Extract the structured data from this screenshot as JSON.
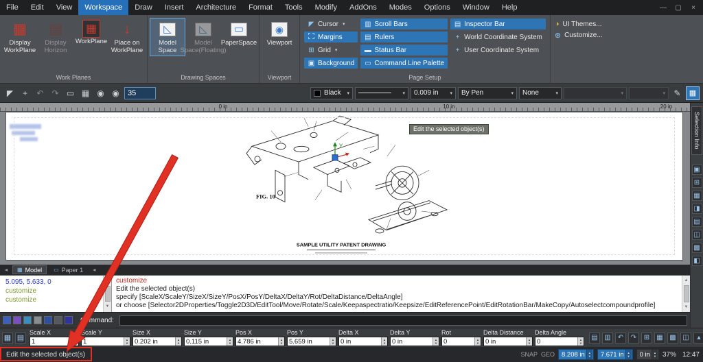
{
  "colors": {
    "accent_blue": "#2e75b6",
    "annotation_red": "#e13024",
    "history_red": "#c3231a",
    "history_green": "#7f9a33",
    "history_blue": "#2b3fd0",
    "ribbon_gray": "#4d5054"
  },
  "icons": {
    "caret": "▾",
    "spin_up": "▲",
    "spin_down": "▼",
    "nav_left": "◂",
    "scroll_up": "▲",
    "scroll_down": "▼"
  },
  "window_controls": {
    "minimize": "—",
    "maximize": "▢",
    "close": "×"
  },
  "menubar": {
    "items": [
      "File",
      "Edit",
      "View",
      "Workspace",
      "Draw",
      "Insert",
      "Architecture",
      "Format",
      "Tools",
      "Modify",
      "AddOns",
      "Modes",
      "Options",
      "Window",
      "Help"
    ]
  },
  "ribbon": {
    "work_planes": {
      "label": "Work Planes",
      "buttons": [
        {
          "label": "Display WorkPlane",
          "icon": "▦"
        },
        {
          "label": "Display Horizon",
          "icon": "▤"
        },
        {
          "label": "WorkPlane",
          "icon": "▦"
        },
        {
          "label": "Place on WorkPlane",
          "icon": "↓"
        }
      ]
    },
    "drawing_spaces": {
      "label": "Drawing Spaces",
      "buttons": [
        {
          "label": "Model Space",
          "icon": "◺"
        },
        {
          "label": "Model Space(Floating)",
          "icon": "◺"
        },
        {
          "label": "PaperSpace",
          "icon": "▭"
        }
      ]
    },
    "viewport_group": {
      "label": "Viewport",
      "buttons": [
        {
          "label": "Viewport",
          "icon": "◉"
        }
      ]
    },
    "page_setup": {
      "label": "Page Setup",
      "toggles": [
        {
          "label": "Cursor",
          "icon": "◤"
        },
        {
          "label": "Margins",
          "icon": ""
        },
        {
          "label": "Grid",
          "icon": "⊞"
        },
        {
          "label": "Background",
          "icon": "▣"
        },
        {
          "label": "Scroll Bars",
          "icon": "▥"
        },
        {
          "label": "Rulers",
          "icon": "▤"
        },
        {
          "label": "Status Bar",
          "icon": "▬"
        },
        {
          "label": "Command Line Palette",
          "icon": "▭"
        },
        {
          "label": "Inspector Bar",
          "icon": "▤"
        },
        {
          "label": "World Coordinate System",
          "icon": "+"
        },
        {
          "label": "User Coordinate System",
          "icon": "+"
        }
      ]
    },
    "extras": {
      "ui_themes": {
        "label": "UI Themes...",
        "icon": "◑"
      },
      "customize": {
        "label": "Customize...",
        "icon": "⊛"
      }
    }
  },
  "toolbar": {
    "icons": [
      "◤",
      "+",
      "↶",
      "↷",
      "▭",
      "▦",
      "◉",
      "◉"
    ],
    "zoom_value": "35",
    "color_label": "Black",
    "lineweight": "0.009 in",
    "plot_style": "By Pen",
    "transparency": "None",
    "pen_icon": "✎",
    "end_icon": "▦"
  },
  "ruler": {
    "labels": [
      "0 in",
      "10 in",
      "20 in"
    ]
  },
  "canvas": {
    "tooltip": "Edit the selected object(s)",
    "axis_label": "Y",
    "fig_label": "FIG. 10",
    "caption": "SAMPLE UTILITY PATENT DRAWING"
  },
  "sheet_tabs": {
    "tabs": [
      {
        "label": "Model"
      },
      {
        "label": "Paper 1"
      }
    ]
  },
  "history": {
    "left": [
      "5.095, 5.633, 0",
      "customize",
      "customize"
    ],
    "right": [
      "customize",
      "Edit the selected object(s)",
      "specify [ScaleX/ScaleY/SizeX/SizeY/PosX/PosY/DeltaX/DeltaY/Rot/DeltaDistance/DeltaAngle]",
      "or choose [Selector2DProperties/Toggle2D3D/EditTool/Move/Rotate/Scale/Keepaspectratio/Keepsize/EditReferencePoint/EditRotationBar/MakeCopy/Autoselectcompoundprofile]"
    ]
  },
  "command": {
    "label": "Command:",
    "value": ""
  },
  "inspector": {
    "fields": [
      {
        "label": "Scale X",
        "value": "1"
      },
      {
        "label": "Scale Y",
        "value": "1"
      },
      {
        "label": "Size X",
        "value": "0.202 in"
      },
      {
        "label": "Size Y",
        "value": "0.115 in"
      },
      {
        "label": "Pos X",
        "value": "4.786 in"
      },
      {
        "label": "Pos Y",
        "value": "5.659 in"
      },
      {
        "label": "Delta X",
        "value": "0 in"
      },
      {
        "label": "Delta Y",
        "value": "0 in"
      },
      {
        "label": "Rot",
        "value": "0"
      },
      {
        "label": "Delta Distance",
        "value": "0 in"
      },
      {
        "label": "Delta Angle",
        "value": "0"
      }
    ],
    "icons": [
      "▤",
      "▥",
      "↶",
      "↷",
      "⊞",
      "▦",
      "▩",
      "◫",
      "▴",
      "◼"
    ]
  },
  "statusbar": {
    "message": "Edit the selected object(s)",
    "snap": "SNAP",
    "geo": "GEO",
    "x": "8.208 in",
    "y": "7.671 in",
    "z": "0 in",
    "zoom": "37%",
    "time": "12:47"
  },
  "side_panel": {
    "title": "Selection Info",
    "icons": [
      "▣",
      "⊞",
      "▦",
      "◨",
      "▤",
      "◫",
      "▩",
      "◧"
    ]
  }
}
